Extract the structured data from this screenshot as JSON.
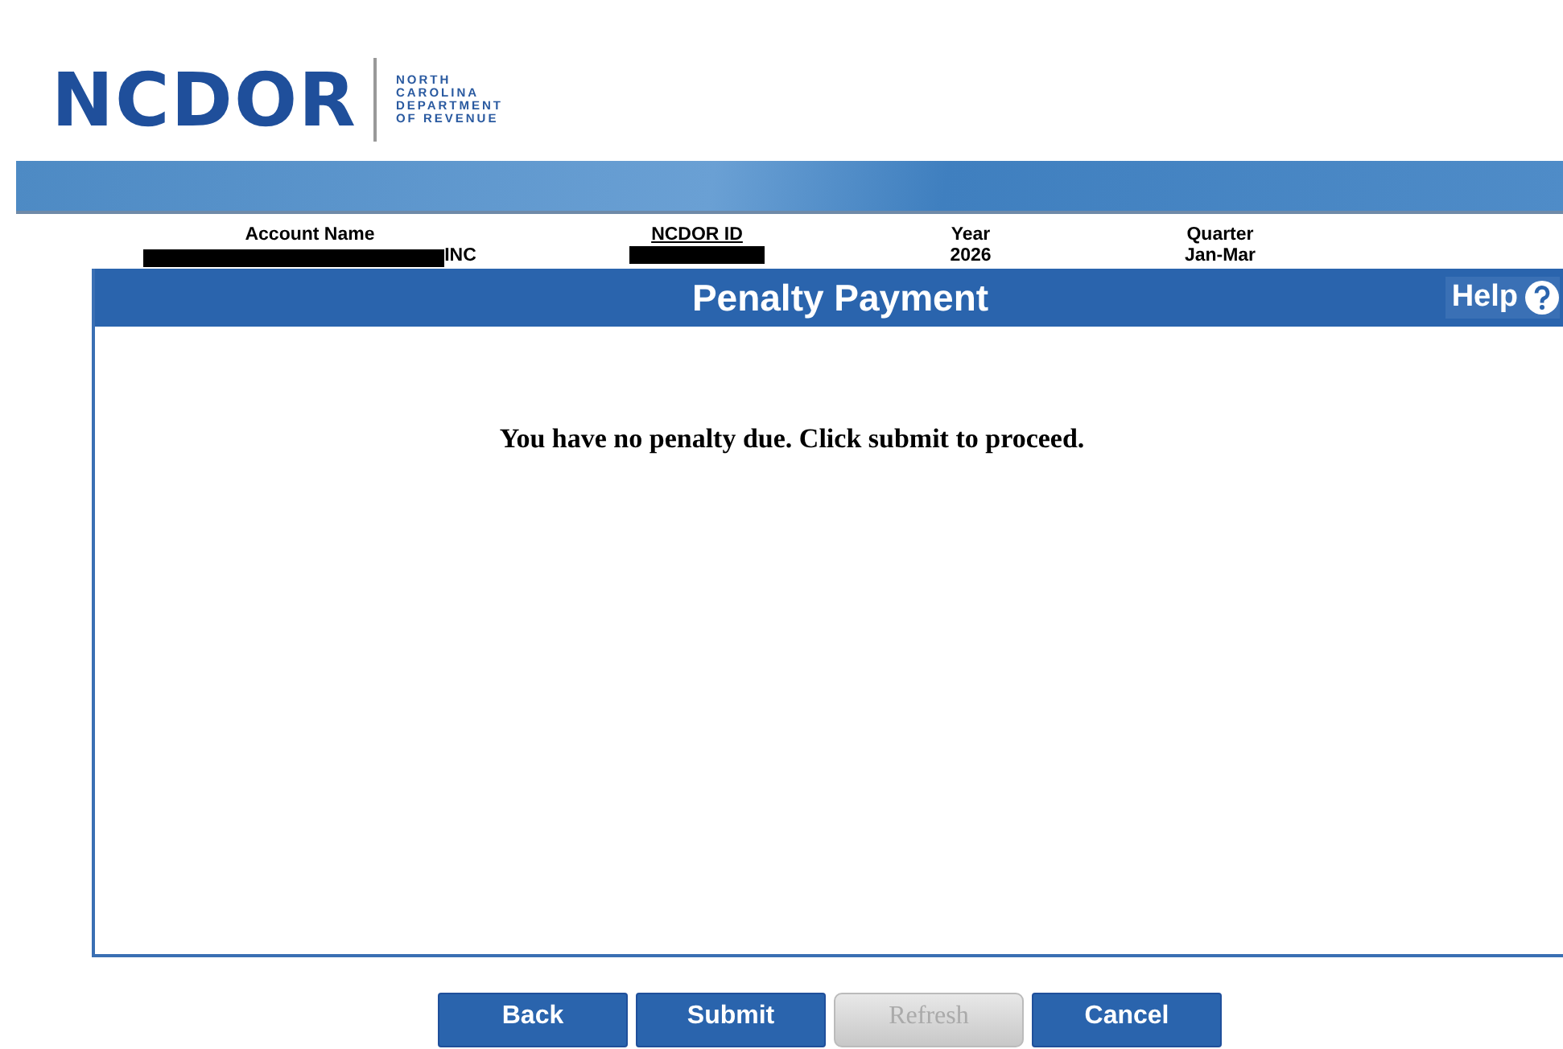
{
  "logo": {
    "wordmark": "NCDOR",
    "agency_lines": [
      "NORTH",
      "CAROLINA",
      "DEPARTMENT",
      "OF REVENUE"
    ]
  },
  "account_info": [
    {
      "label": "Account Name",
      "value": "INC",
      "redacted": true
    },
    {
      "label": "NCDOR ID",
      "redacted": true
    },
    {
      "label": "Year",
      "value": "2026",
      "redacted": false
    },
    {
      "label": "Quarter",
      "value": "Jan-Mar",
      "redacted": false
    }
  ],
  "panel": {
    "title": "Penalty Payment",
    "help": "Help",
    "message": "You have no penalty due. Click submit to proceed."
  },
  "buttons": [
    {
      "label": "Back",
      "disabled": false
    },
    {
      "label": "Submit",
      "disabled": false
    },
    {
      "label": "Refresh",
      "disabled": true
    },
    {
      "label": "Cancel",
      "disabled": false
    }
  ]
}
